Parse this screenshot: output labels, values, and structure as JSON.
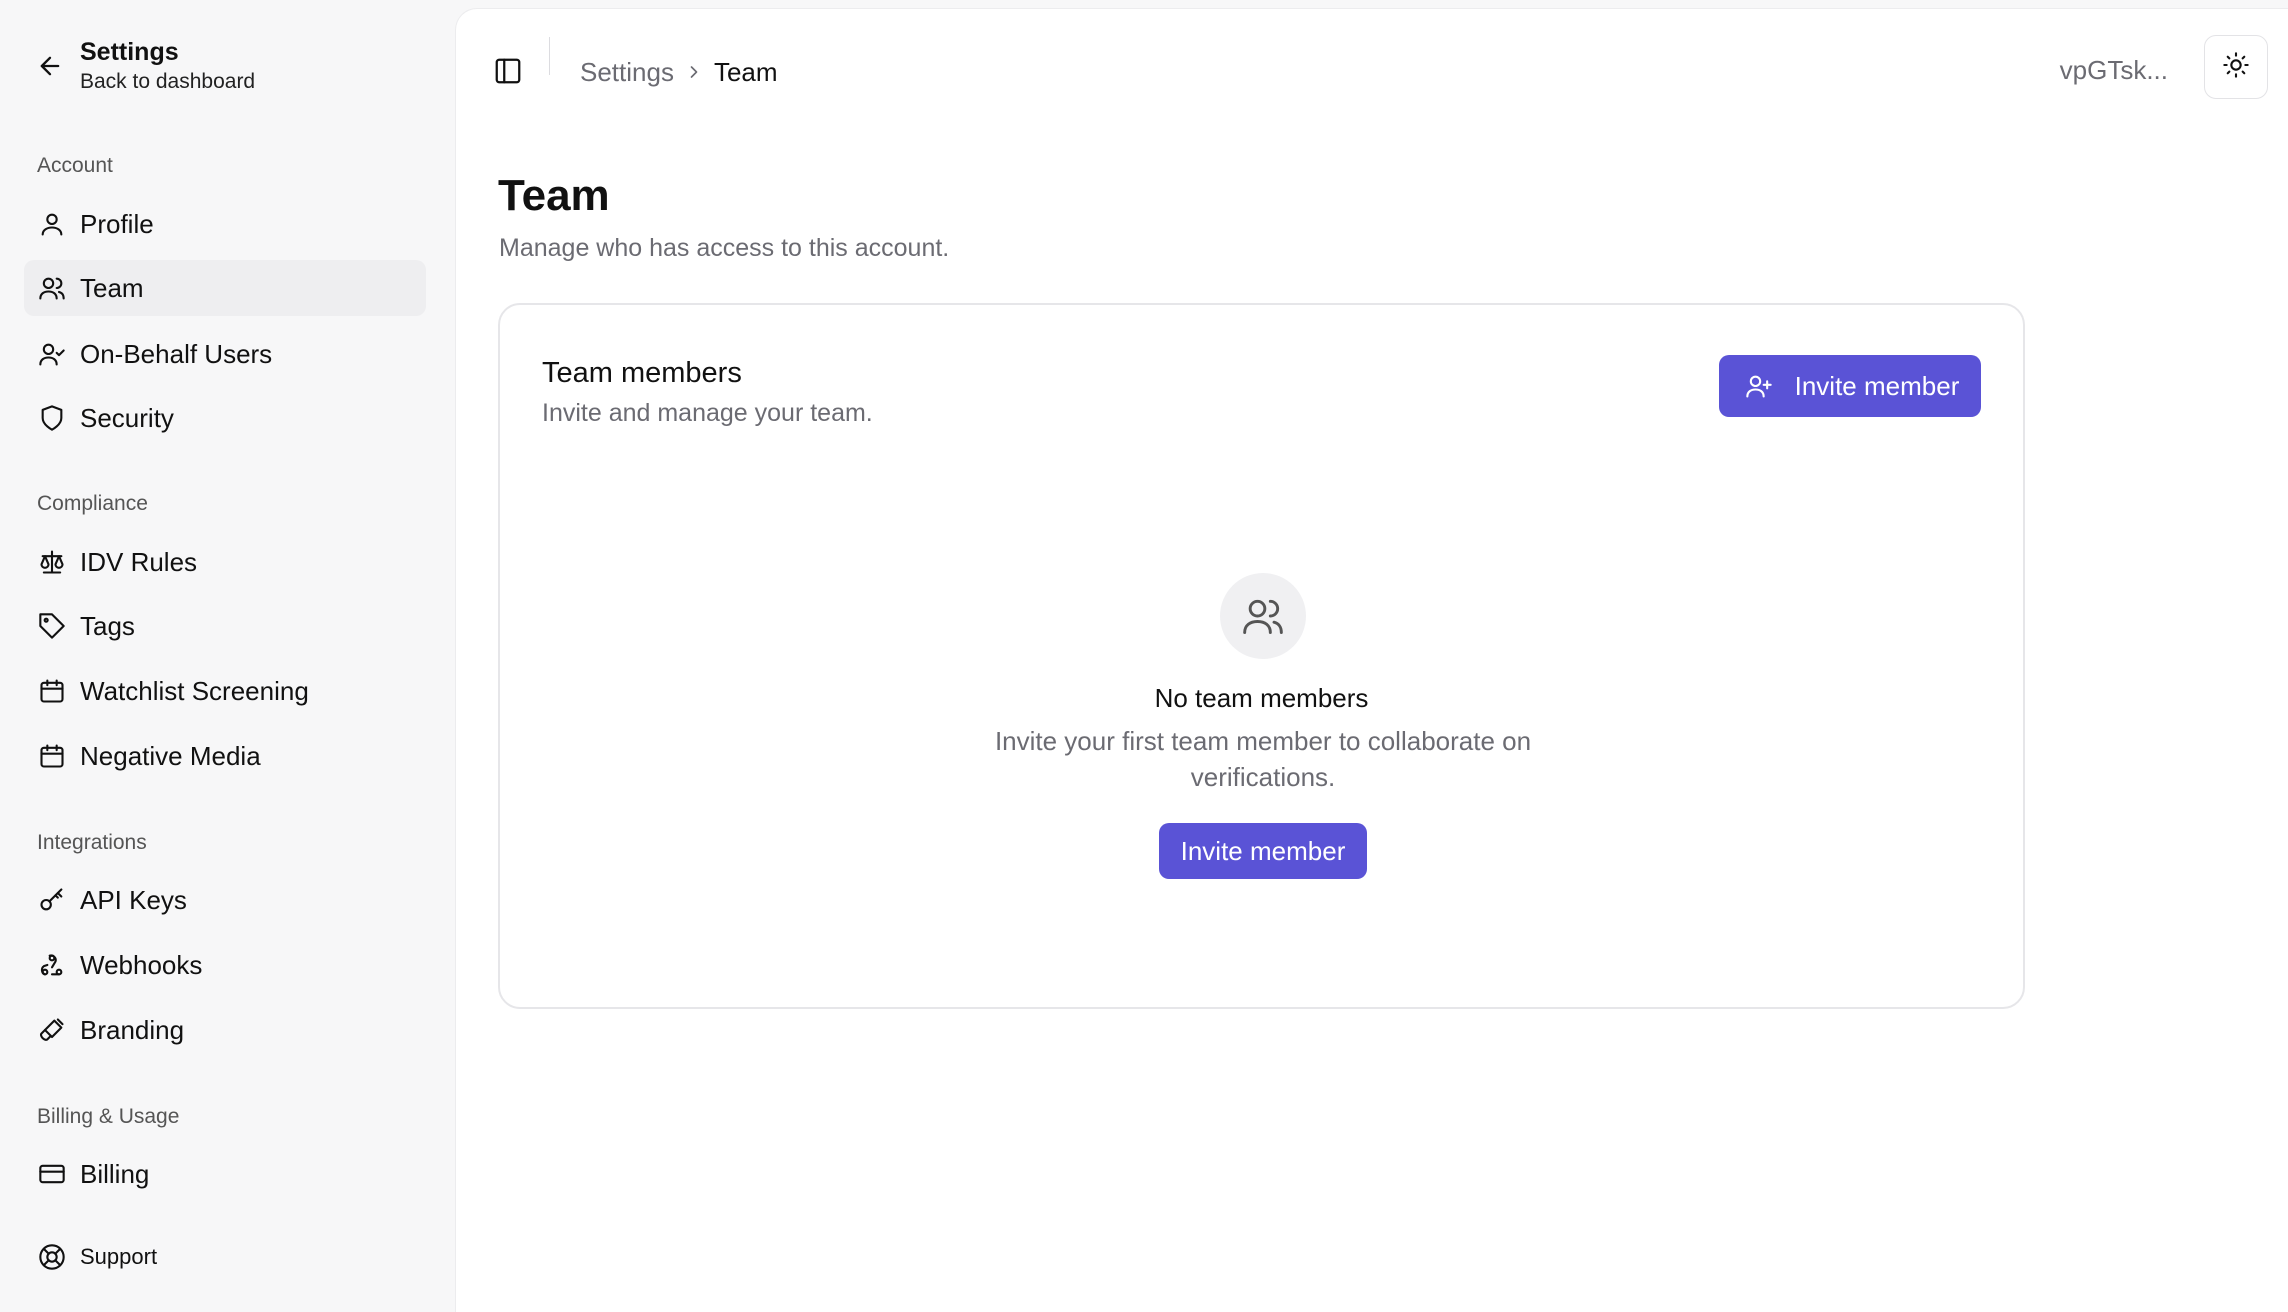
{
  "sidebar": {
    "back": {
      "title": "Settings",
      "subtitle": "Back to dashboard"
    },
    "sections": {
      "account": "Account",
      "compliance": "Compliance",
      "integrations": "Integrations",
      "billing": "Billing & Usage"
    },
    "items": {
      "profile": "Profile",
      "team": "Team",
      "on_behalf": "On-Behalf Users",
      "security": "Security",
      "idv_rules": "IDV Rules",
      "tags": "Tags",
      "watchlist": "Watchlist Screening",
      "negative_media": "Negative Media",
      "api_keys": "API Keys",
      "webhooks": "Webhooks",
      "branding": "Branding",
      "billing": "Billing",
      "support": "Support"
    },
    "active_item": "team"
  },
  "topbar": {
    "breadcrumb": {
      "parent": "Settings",
      "current": "Team"
    },
    "account_label": "vpGTsk..."
  },
  "page": {
    "title": "Team",
    "subtitle": "Manage who has access to this account."
  },
  "card": {
    "title": "Team members",
    "subtitle": "Invite and manage your team.",
    "invite_label": "Invite member",
    "empty": {
      "title": "No team members",
      "description": "Invite your first team member to collaborate on verifications.",
      "button_label": "Invite member"
    }
  },
  "colors": {
    "accent": "#5a53d6",
    "sidebar_bg": "#f7f7f8",
    "active_item_bg": "#eeeef0",
    "muted_text": "#6b6b72"
  },
  "icons": {
    "back": "arrow-left-icon",
    "profile": "user-icon",
    "team": "users-icon",
    "on_behalf": "user-check-icon",
    "security": "shield-icon",
    "idv_rules": "scale-icon",
    "tags": "tag-icon",
    "watchlist": "calendar-icon",
    "negative_media": "calendar-icon",
    "api_keys": "key-icon",
    "webhooks": "webhook-icon",
    "branding": "paintbrush-icon",
    "billing": "credit-card-icon",
    "support": "life-buoy-icon",
    "sidebar_toggle": "panel-left-icon",
    "theme": "sun-icon",
    "invite": "user-plus-icon"
  }
}
